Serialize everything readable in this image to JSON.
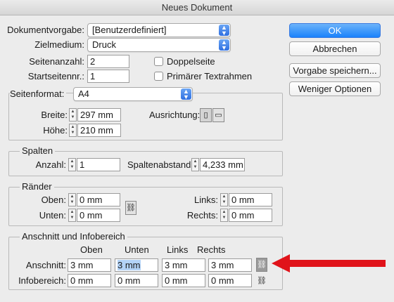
{
  "window": {
    "title": "Neues Dokument"
  },
  "document": {
    "preset_label": "Dokumentvorgabe:",
    "preset_value": "[Benutzerdefiniert]",
    "intent_label": "Zielmedium:",
    "intent_value": "Druck",
    "pages_label": "Seitenanzahl:",
    "pages_value": "2",
    "start_label": "Startseitennr.:",
    "start_value": "1",
    "facing_label": "Doppelseite",
    "facing_checked": false,
    "primary_frame_label": "Primärer Textrahmen",
    "primary_frame_checked": false
  },
  "buttons": {
    "ok": "OK",
    "cancel": "Abbrechen",
    "save_preset": "Vorgabe speichern...",
    "fewer_options": "Weniger Optionen"
  },
  "page_size": {
    "label": "Seitenformat:",
    "value": "A4",
    "width_label": "Breite:",
    "width_value": "297 mm",
    "height_label": "Höhe:",
    "height_value": "210 mm",
    "orientation_label": "Ausrichtung:"
  },
  "columns": {
    "title": "Spalten",
    "count_label": "Anzahl:",
    "count_value": "1",
    "gutter_label": "Spaltenabstand:",
    "gutter_value": "4,233 mm"
  },
  "margins": {
    "title": "Ränder",
    "top_label": "Oben:",
    "top_value": "0 mm",
    "bottom_label": "Unten:",
    "bottom_value": "0 mm",
    "left_label": "Links:",
    "left_value": "0 mm",
    "right_label": "Rechts:",
    "right_value": "0 mm"
  },
  "bleed_slug": {
    "title": "Anschnitt und Infobereich",
    "col_top": "Oben",
    "col_bottom": "Unten",
    "col_left": "Links",
    "col_right": "Rechts",
    "bleed_label": "Anschnitt:",
    "bleed_values": [
      "3 mm",
      "3 mm",
      "3 mm",
      "3 mm"
    ],
    "slug_label": "Infobereich:",
    "slug_values": [
      "0 mm",
      "0 mm",
      "0 mm",
      "0 mm"
    ]
  },
  "colors": {
    "accent": "#1a82fb",
    "arrow": "#e0131a"
  },
  "icons": [
    "chevron-updown-icon",
    "stepper-icon",
    "portrait-icon",
    "landscape-icon",
    "chain-link-icon",
    "arrow-annotation"
  ]
}
